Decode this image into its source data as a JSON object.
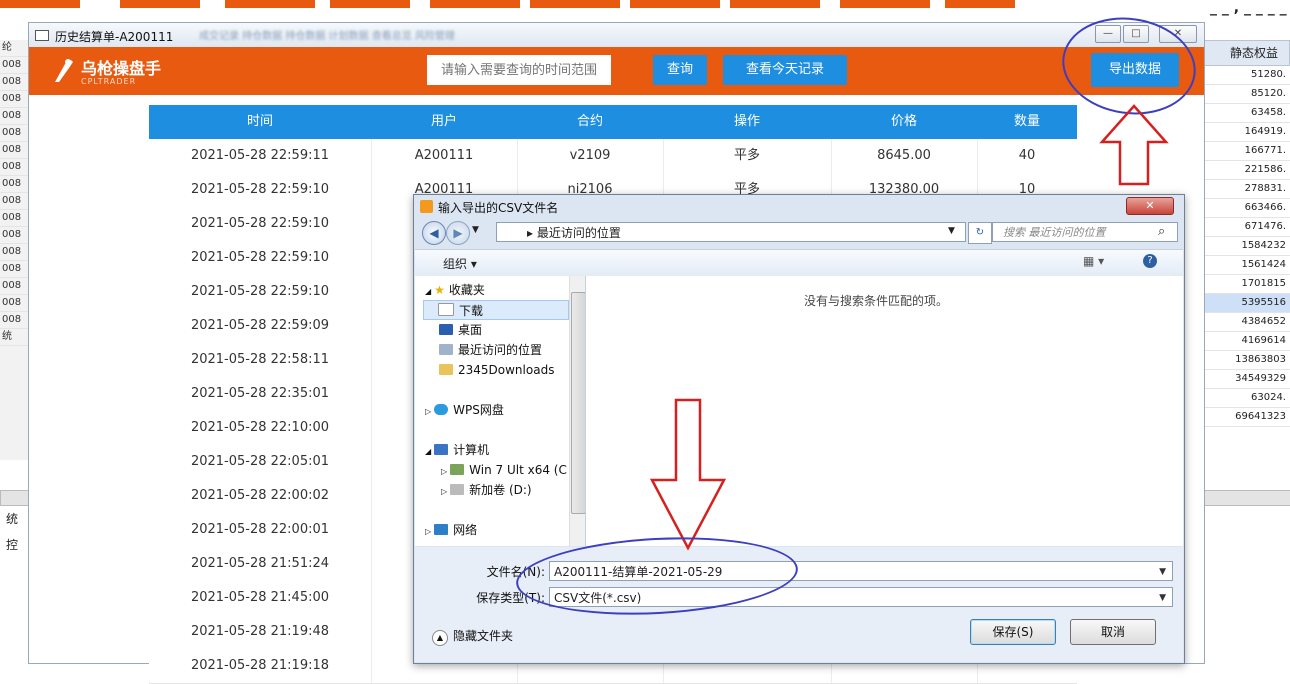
{
  "window": {
    "title": "历史结算单-A200111",
    "blurred_menu": "成交记录  持仓数据  持仓数据  计划数据  查看总览  风险管理",
    "controls": {
      "minimize": "—",
      "maximize": "□",
      "close": "✕"
    }
  },
  "header": {
    "logo_cn": "乌枪操盘手",
    "logo_en": "CPLTRADER",
    "search_placeholder": "请输入需要查询的时间范围",
    "query_button": "查询",
    "today_button": "查看今天记录",
    "export_button": "导出数据"
  },
  "table": {
    "columns": [
      "时间",
      "用户",
      "合约",
      "操作",
      "价格",
      "数量"
    ],
    "rows": [
      {
        "time": "2021-05-28 22:59:11",
        "user": "A200111",
        "contract": "v2109",
        "op": "平多",
        "price": "8645.00",
        "qty": "40"
      },
      {
        "time": "2021-05-28 22:59:10",
        "user": "A200111",
        "contract": "ni2106",
        "op": "平多",
        "price": "132380.00",
        "qty": "10"
      },
      {
        "time": "2021-05-28 22:59:10"
      },
      {
        "time": "2021-05-28 22:59:10"
      },
      {
        "time": "2021-05-28 22:59:10"
      },
      {
        "time": "2021-05-28 22:59:09"
      },
      {
        "time": "2021-05-28 22:58:11"
      },
      {
        "time": "2021-05-28 22:35:01"
      },
      {
        "time": "2021-05-28 22:10:00"
      },
      {
        "time": "2021-05-28 22:05:01"
      },
      {
        "time": "2021-05-28 22:00:02"
      },
      {
        "time": "2021-05-28 22:00:01"
      },
      {
        "time": "2021-05-28 21:51:24"
      },
      {
        "time": "2021-05-28 21:45:00"
      },
      {
        "time": "2021-05-28 21:19:48"
      },
      {
        "time": "2021-05-28 21:19:18"
      }
    ]
  },
  "left_col": [
    "纶",
    "008",
    "008",
    "008",
    "008",
    "008",
    "008",
    "008",
    "008",
    "008",
    "008",
    "008",
    "008",
    "008",
    "008",
    "008",
    "008",
    "统"
  ],
  "left_col_lower": [
    "统",
    "控"
  ],
  "right_col": {
    "header": "静态权益",
    "values": [
      "51280.",
      "85120.",
      "63458.",
      "164919.",
      "166771.",
      "221586.",
      "278831.",
      "663466.",
      "671476.",
      "1584232",
      "1561424",
      "1701815",
      "5395516",
      "4384652",
      "4169614",
      "13863803",
      "34549329",
      "63024.",
      "69641323"
    ],
    "selected_index": 12
  },
  "top_right_text": "_ _ , _ _ _ _",
  "dialog": {
    "title": "输入导出的CSV文件名",
    "close": "✕",
    "address": "▸ 最近访问的位置",
    "search_placeholder": "搜索 最近访问的位置",
    "organize": "组织 ▾",
    "no_match": "没有与搜索条件匹配的项。",
    "nav": {
      "favorites": "收藏夹",
      "downloads": "下载",
      "desktop": "桌面",
      "recent": "最近访问的位置",
      "folder2345": "2345Downloads",
      "wps": "WPS网盘",
      "computer": "计算机",
      "win7": "Win 7 Ult x64 (C",
      "newvol": "新加卷 (D:)",
      "network": "网络"
    },
    "filename_label": "文件名(N):",
    "filename_value": "A200111-结算单-2021-05-29",
    "filetype_label": "保存类型(T):",
    "filetype_value": "CSV文件(*.csv)",
    "hide_folders": "隐藏文件夹",
    "save_button": "保存(S)",
    "cancel_button": "取消"
  },
  "colors": {
    "brand_orange": "#e85a10",
    "accent_blue": "#1e8fe0",
    "annotation_red": "#d62020",
    "annotation_blue": "#3d3fc0"
  }
}
